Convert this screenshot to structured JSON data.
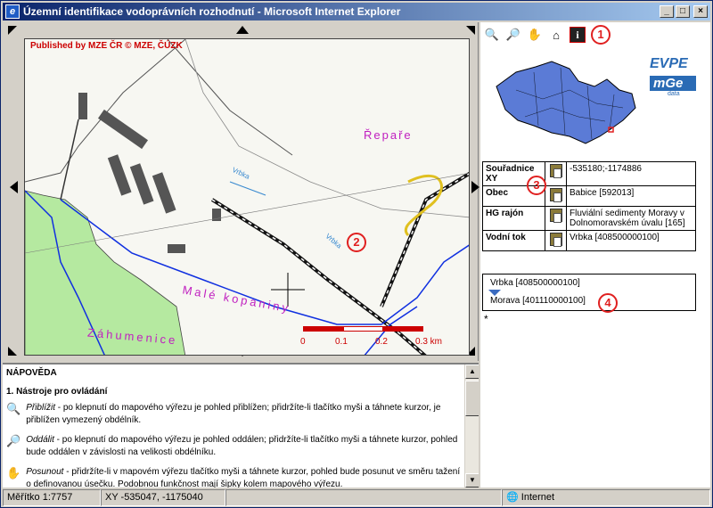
{
  "window": {
    "title": "Územní identifikace vodoprávních rozhodnutí - Microsoft Internet Explorer",
    "minimize": "_",
    "maximize": "□",
    "close": "×"
  },
  "map": {
    "credit": "Published by MZE ČR   © MZE, ČÚZK",
    "labels": {
      "repare": "Řepaře",
      "vrbka1": "Vrbka",
      "vrbka2": "Vrbka",
      "male_kopaniny": "Malé kopaniny",
      "zahumenice": "Záhumenice"
    },
    "scale": {
      "labels": [
        "0",
        "0.1",
        "0.2",
        "0.3 km"
      ]
    }
  },
  "callouts": [
    "1",
    "2",
    "3",
    "4"
  ],
  "toolbar": {
    "tools": [
      "zoom-in-icon",
      "zoom-out-icon",
      "pan-hand-icon",
      "identify-icon",
      "info-icon"
    ]
  },
  "logo": {
    "evpe": "EVPE",
    "mge": "mGe",
    "data": "data"
  },
  "info_table": [
    {
      "key": "Souřadnice XY",
      "value": "-535180;-1174886"
    },
    {
      "key": "Obec",
      "value": "Babice [592013]"
    },
    {
      "key": "HG rajón",
      "value": "Fluviální sedimenty Moravy v Dolnomoravském úvalu [165]"
    },
    {
      "key": "Vodní tok",
      "value": "Vrbka [408500000100]"
    }
  ],
  "streams": {
    "first": "Vrbka [408500000100]",
    "second": "Morava [401110000100]"
  },
  "asterisk": "*",
  "help": {
    "title": "NÁPOVĚDA",
    "section": "1. Nástroje pro ovládání",
    "items": [
      {
        "name": "Přiblížit",
        "text": " - po klepnutí do mapového výřezu je pohled přiblížen; přidržíte-li tlačítko myši a táhnete kurzor, je přiblížen vymezený obdélník."
      },
      {
        "name": "Oddálit",
        "text": " - po klepnutí do mapového výřezu je pohled oddálen; přidržíte-li tlačítko myši a táhnete kurzor, pohled bude oddálen v závislosti na velikosti obdélníku."
      },
      {
        "name": "Posunout",
        "text": " - přidržíte-li v mapovém výřezu tlačítko myši a táhnete kurzor, pohled bude posunut ve směru tažení o definovanou úsečku. Podobnou funkčnost mají šipky kolem mapového výřezu."
      }
    ]
  },
  "statusbar": {
    "scale": "Měřítko 1:7757",
    "coords": "XY -535047, -1175040",
    "zone": "Internet"
  },
  "colors": {
    "titlebar_start": "#0a246a",
    "callout": "#e02020",
    "map_label_magenta": "#c020c0",
    "river_blue": "#1030e0",
    "scale_red": "#cc0000"
  }
}
